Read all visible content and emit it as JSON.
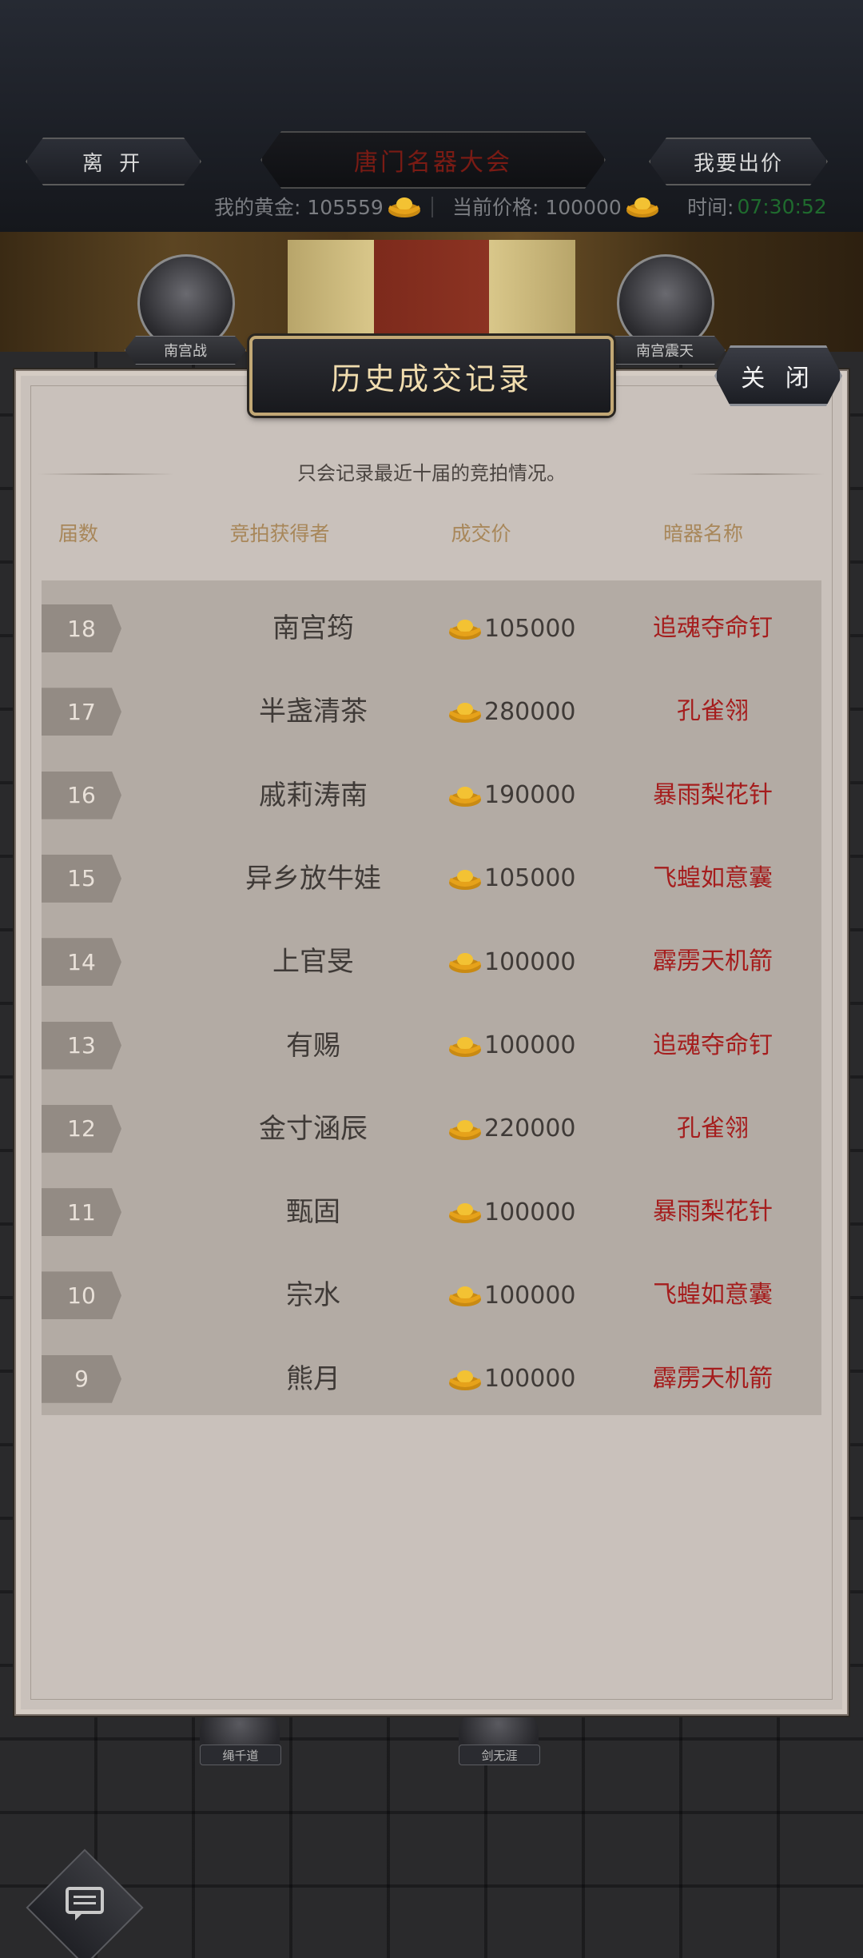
{
  "header": {
    "leave_label": "离 开",
    "title": "唐门名器大会",
    "bid_label": "我要出价",
    "gold_label": "我的黄金: 105559",
    "price_label": "当前价格: 100000",
    "time_prefix": "时间:",
    "time_value": "07:30:52"
  },
  "scene": {
    "left_player": "南宫战",
    "right_player": "南宫震天",
    "lower_left_player": "绳千道",
    "lower_right_player": "剑无涯"
  },
  "dialog": {
    "title": "历史成交记录",
    "close_label": "关 闭",
    "note": "只会记录最近十届的竞拍情况。",
    "columns": [
      "届数",
      "竞拍获得者",
      "成交价",
      "暗器名称"
    ],
    "rows": [
      {
        "round": "18",
        "winner": "南宫筠",
        "price": "105000",
        "weapon": "追魂夺命钉"
      },
      {
        "round": "17",
        "winner": "半盏清茶",
        "price": "280000",
        "weapon": "孔雀翎"
      },
      {
        "round": "16",
        "winner": "戚莉涛南",
        "price": "190000",
        "weapon": "暴雨梨花针"
      },
      {
        "round": "15",
        "winner": "异乡放牛娃",
        "price": "105000",
        "weapon": "飞蝗如意囊"
      },
      {
        "round": "14",
        "winner": "上官旻",
        "price": "100000",
        "weapon": "霹雳天机箭"
      },
      {
        "round": "13",
        "winner": "有赐",
        "price": "100000",
        "weapon": "追魂夺命钉"
      },
      {
        "round": "12",
        "winner": "金寸涵辰",
        "price": "220000",
        "weapon": "孔雀翎"
      },
      {
        "round": "11",
        "winner": "甄固",
        "price": "100000",
        "weapon": "暴雨梨花针"
      },
      {
        "round": "10",
        "winner": "宗水",
        "price": "100000",
        "weapon": "飞蝗如意囊"
      },
      {
        "round": "9",
        "winner": "熊月",
        "price": "100000",
        "weapon": "霹雳天机箭"
      }
    ]
  },
  "icons": {
    "gold": "gold-ingot-icon",
    "chat": "chat-icon"
  },
  "colors": {
    "weapon_text": "#a51d1d",
    "header_text": "#a8875a",
    "timer": "#1f6b2e",
    "title_text": "#7a1b14"
  }
}
